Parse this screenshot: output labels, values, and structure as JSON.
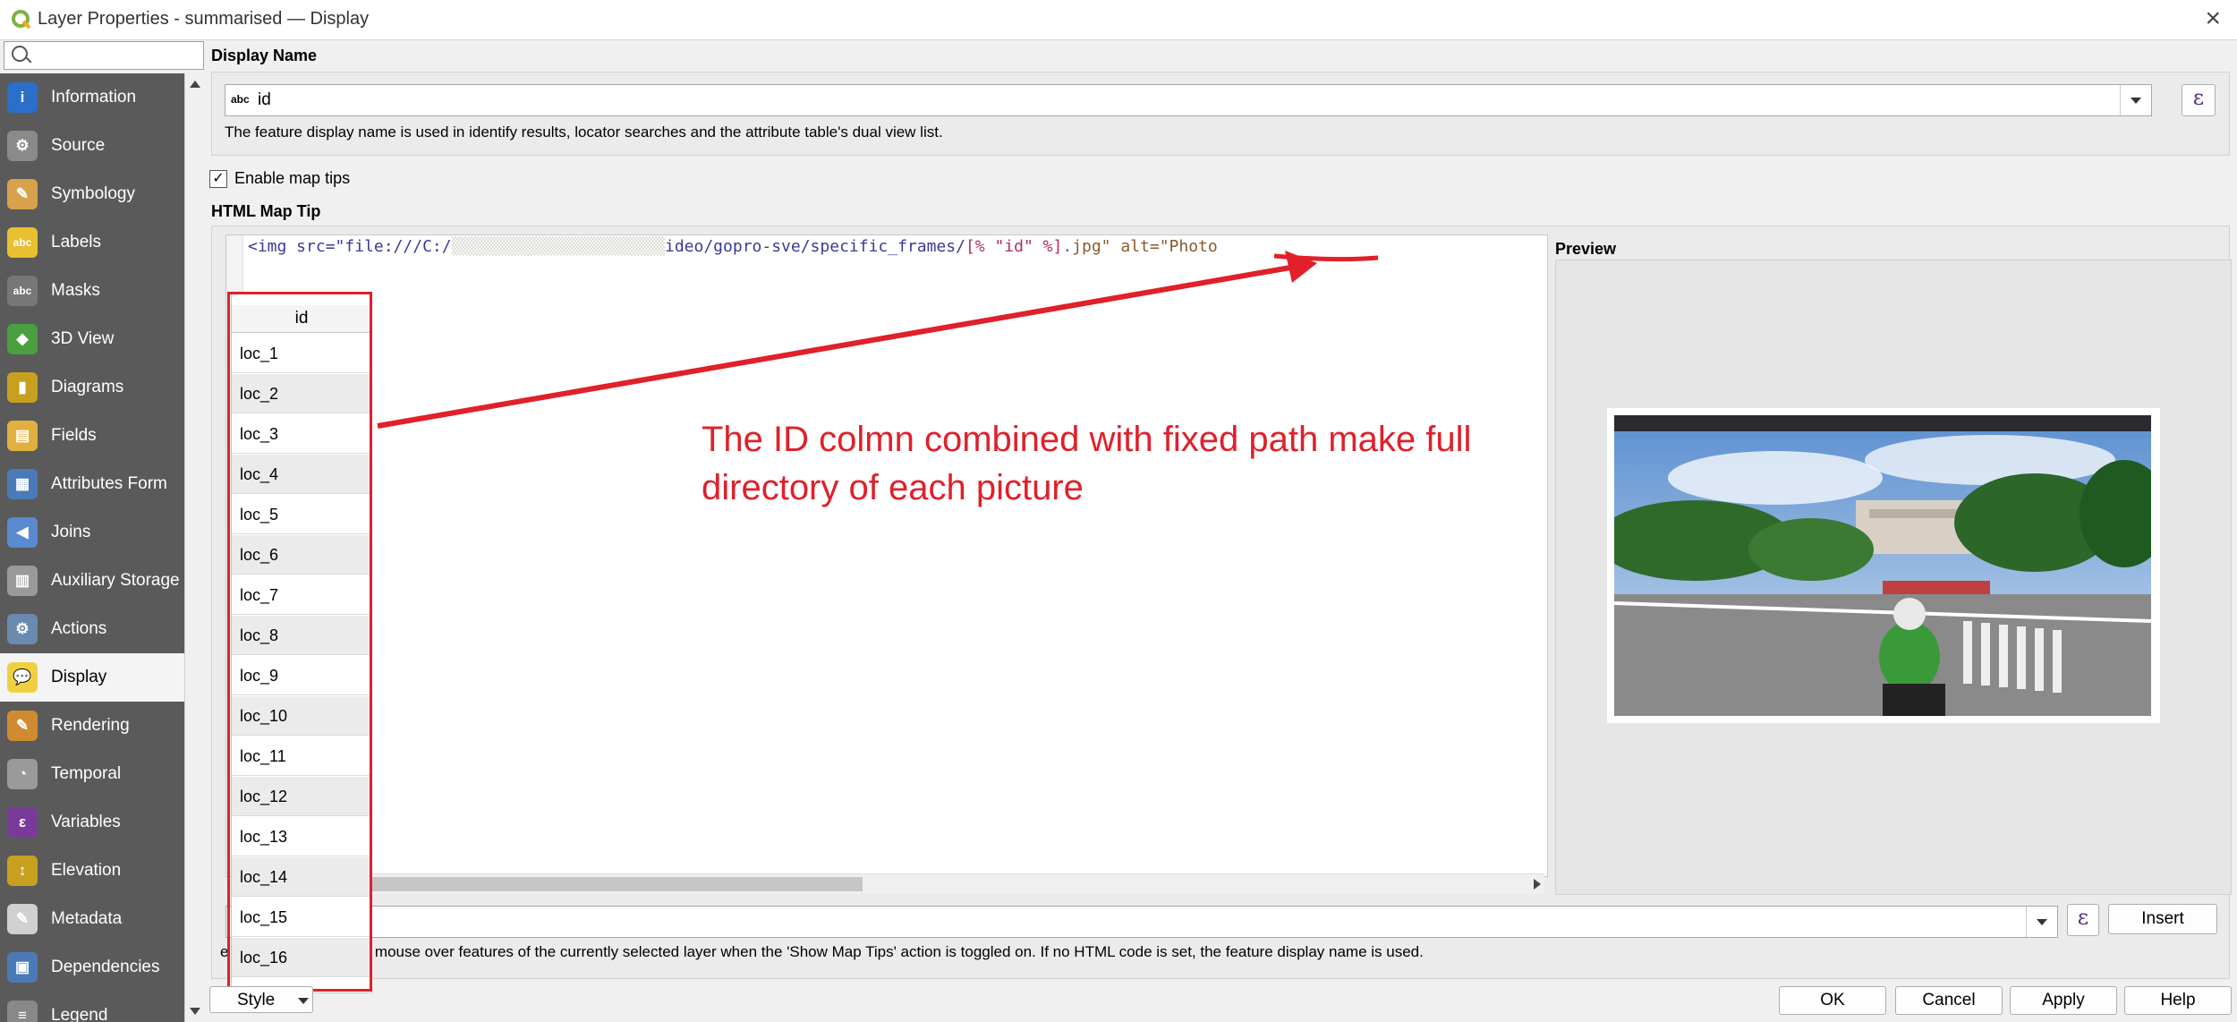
{
  "window": {
    "title": "Layer Properties - summarised — Display"
  },
  "sidebar": {
    "search_placeholder": "",
    "items": [
      {
        "label": "Information",
        "icon": "information-icon",
        "color": "#2a6fc9"
      },
      {
        "label": "Source",
        "icon": "source-icon",
        "color": "#8a8a8a"
      },
      {
        "label": "Symbology",
        "icon": "symbology-icon",
        "color": "#d8a24a"
      },
      {
        "label": "Labels",
        "icon": "labels-icon",
        "color": "#e8c030"
      },
      {
        "label": "Masks",
        "icon": "masks-icon",
        "color": "#777777"
      },
      {
        "label": "3D View",
        "icon": "3d-view-icon",
        "color": "#4aa040"
      },
      {
        "label": "Diagrams",
        "icon": "diagrams-icon",
        "color": "#c8a020"
      },
      {
        "label": "Fields",
        "icon": "fields-icon",
        "color": "#e0b040"
      },
      {
        "label": "Attributes Form",
        "icon": "attributes-form-icon",
        "color": "#4a7ab8"
      },
      {
        "label": "Joins",
        "icon": "joins-icon",
        "color": "#5a8ad0"
      },
      {
        "label": "Auxiliary Storage",
        "icon": "auxiliary-storage-icon",
        "color": "#9a9a9a"
      },
      {
        "label": "Actions",
        "icon": "actions-icon",
        "color": "#6a8ab0"
      },
      {
        "label": "Display",
        "icon": "display-icon",
        "color": "#f0d040"
      },
      {
        "label": "Rendering",
        "icon": "rendering-icon",
        "color": "#d08a30"
      },
      {
        "label": "Temporal",
        "icon": "temporal-icon",
        "color": "#9a9a9a"
      },
      {
        "label": "Variables",
        "icon": "variables-icon",
        "color": "#7a3a9a"
      },
      {
        "label": "Elevation",
        "icon": "elevation-icon",
        "color": "#c8a020"
      },
      {
        "label": "Metadata",
        "icon": "metadata-icon",
        "color": "#d0d0d0"
      },
      {
        "label": "Dependencies",
        "icon": "dependencies-icon",
        "color": "#4a7ab8"
      },
      {
        "label": "Legend",
        "icon": "legend-icon",
        "color": "#888888"
      }
    ],
    "active": "Display"
  },
  "display_name": {
    "section_label": "Display Name",
    "type_badge": "abc",
    "value": "id",
    "help": "The feature display name is used in identify results, locator searches and the attribute table's dual view list."
  },
  "map_tips": {
    "checkbox_label": "Enable map tips",
    "checked": true,
    "html_label": "HTML Map Tip",
    "code_prefix": "<img src=\"file:///C:/",
    "code_redacted": "▒▒▒▒▒▒▒▒▒▒▒▒▒▒▒▒▒▒▒▒▒▒",
    "code_path": "ideo/gopro-sve/specific_frames/",
    "code_expr": "[% \"id\" %]",
    "code_suffix": ".jpg\" alt=\"Photo",
    "preview_label": "Preview",
    "insert_label": "Insert",
    "help_text": "e shown when moving mouse over features of the currently selected layer when the 'Show Map Tips' action is toggled on. If no HTML code is set, the feature display name is used."
  },
  "id_table": {
    "header": "id",
    "rows": [
      "loc_1",
      "loc_2",
      "loc_3",
      "loc_4",
      "loc_5",
      "loc_6",
      "loc_7",
      "loc_8",
      "loc_9",
      "loc_10",
      "loc_11",
      "loc_12",
      "loc_13",
      "loc_14",
      "loc_15",
      "loc_16"
    ]
  },
  "annotation": {
    "text": "The ID colmn combined with fixed path make full directory of each picture",
    "color": "#e0202a"
  },
  "buttons": {
    "style": "Style",
    "ok": "OK",
    "cancel": "Cancel",
    "apply": "Apply",
    "help": "Help"
  }
}
